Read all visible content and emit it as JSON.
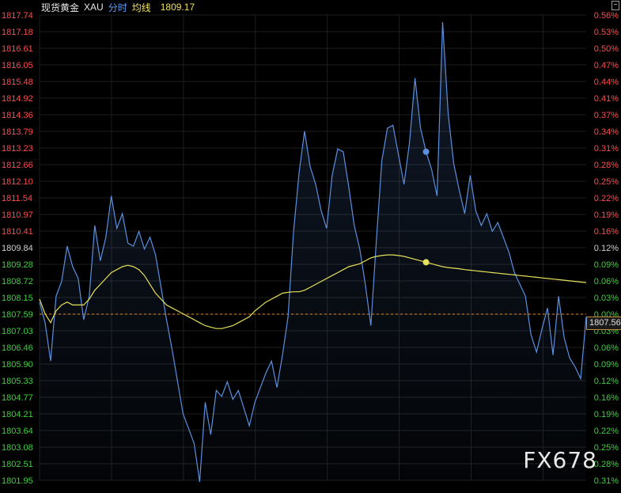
{
  "header": {
    "name": "现货黄金",
    "code": "XAU",
    "mode": "分时",
    "avg_label": "均线",
    "avg_value": "1809.17"
  },
  "watermark": "FX678",
  "last_price_label": "1807.56",
  "colors": {
    "background": "#000000",
    "price_line": "#5b8fe0",
    "avg_line": "#e6e15a",
    "up": "#ff4d4d",
    "down": "#3fd13f",
    "neutral": "#d0d0d0",
    "prev_close_line": "#d98c3a",
    "grid": "#1e1e1e"
  },
  "chart_data": {
    "type": "line",
    "title": "",
    "prev_close": 1807.59,
    "ylim": [
      1801.95,
      1817.74
    ],
    "y_ticks": [
      "1817.74",
      "1817.18",
      "1816.61",
      "1816.05",
      "1815.48",
      "1814.92",
      "1814.36",
      "1813.79",
      "1813.23",
      "1812.66",
      "1812.10",
      "1811.54",
      "1810.97",
      "1810.41",
      "1809.84",
      "1809.28",
      "1808.72",
      "1808.15",
      "1807.59",
      "1807.03",
      "1806.46",
      "1805.90",
      "1805.33",
      "1804.77",
      "1804.21",
      "1803.64",
      "1803.08",
      "1802.51",
      "1801.95"
    ],
    "pct_ticks": [
      "0.56%",
      "0.53%",
      "0.50%",
      "0.47%",
      "0.44%",
      "0.41%",
      "0.37%",
      "0.34%",
      "0.31%",
      "0.28%",
      "0.25%",
      "0.22%",
      "0.19%",
      "0.16%",
      "0.12%",
      "0.09%",
      "0.06%",
      "0.03%",
      "0.00%",
      "0.03%",
      "0.06%",
      "0.09%",
      "0.12%",
      "0.16%",
      "0.19%",
      "0.22%",
      "0.25%",
      "0.28%",
      "0.31%"
    ],
    "grid": true,
    "x_count": 100,
    "series": [
      {
        "name": "",
        "values": [
          1808.0,
          1807.3,
          1806.0,
          1808.2,
          1808.7,
          1809.9,
          1809.2,
          1808.8,
          1807.4,
          1808.2,
          1810.6,
          1809.4,
          1810.2,
          1811.6,
          1810.5,
          1811.0,
          1810.0,
          1809.9,
          1810.4,
          1809.8,
          1810.2,
          1809.6,
          1808.5,
          1807.4,
          1806.4,
          1805.3,
          1804.2,
          1803.7,
          1803.2,
          1801.9,
          1804.6,
          1803.5,
          1805.0,
          1804.8,
          1805.3,
          1804.7,
          1805.0,
          1804.4,
          1803.8,
          1804.6,
          1805.1,
          1805.6,
          1806.0,
          1805.1,
          1806.2,
          1807.5,
          1810.4,
          1812.4,
          1813.8,
          1812.6,
          1812.0,
          1811.1,
          1810.5,
          1812.3,
          1813.2,
          1813.1,
          1811.9,
          1810.6,
          1809.8,
          1808.6,
          1807.2,
          1810.1,
          1812.8,
          1813.9,
          1814.0,
          1813.0,
          1812.0,
          1813.4,
          1815.6,
          1813.9,
          1813.1,
          1812.5,
          1811.6,
          1817.5,
          1814.4,
          1812.7,
          1811.8,
          1811.0,
          1812.3,
          1811.1,
          1810.6,
          1811.0,
          1810.4,
          1810.7,
          1810.2,
          1809.7,
          1809.0,
          1808.6,
          1808.2,
          1806.9,
          1806.3,
          1807.1,
          1807.8,
          1806.2,
          1808.2,
          1806.8,
          1806.1,
          1805.8,
          1805.4,
          1807.5
        ]
      },
      {
        "name": "均线",
        "values": [
          1808.1,
          1807.6,
          1807.3,
          1807.7,
          1807.9,
          1808.0,
          1807.9,
          1807.9,
          1807.9,
          1808.1,
          1808.4,
          1808.6,
          1808.8,
          1809.0,
          1809.1,
          1809.2,
          1809.25,
          1809.2,
          1809.1,
          1808.9,
          1808.6,
          1808.3,
          1808.1,
          1807.9,
          1807.8,
          1807.7,
          1807.6,
          1807.5,
          1807.4,
          1807.3,
          1807.2,
          1807.15,
          1807.1,
          1807.1,
          1807.15,
          1807.2,
          1807.3,
          1807.4,
          1807.5,
          1807.7,
          1807.85,
          1808.0,
          1808.1,
          1808.2,
          1808.3,
          1808.33,
          1808.35,
          1808.35,
          1808.4,
          1808.5,
          1808.6,
          1808.7,
          1808.8,
          1808.9,
          1809.0,
          1809.1,
          1809.2,
          1809.25,
          1809.3,
          1809.4,
          1809.5,
          1809.55,
          1809.58,
          1809.6,
          1809.6,
          1809.58,
          1809.55,
          1809.5,
          1809.45,
          1809.4,
          1809.35,
          1809.3,
          1809.25,
          1809.2,
          1809.17,
          1809.15,
          1809.13,
          1809.1,
          1809.08,
          1809.06,
          1809.04,
          1809.02,
          1809.0,
          1808.98,
          1808.96,
          1808.94,
          1808.92,
          1808.9,
          1808.88,
          1808.86,
          1808.84,
          1808.82,
          1808.8,
          1808.78,
          1808.76,
          1808.74,
          1808.72,
          1808.7,
          1808.68,
          1808.66
        ]
      }
    ]
  }
}
